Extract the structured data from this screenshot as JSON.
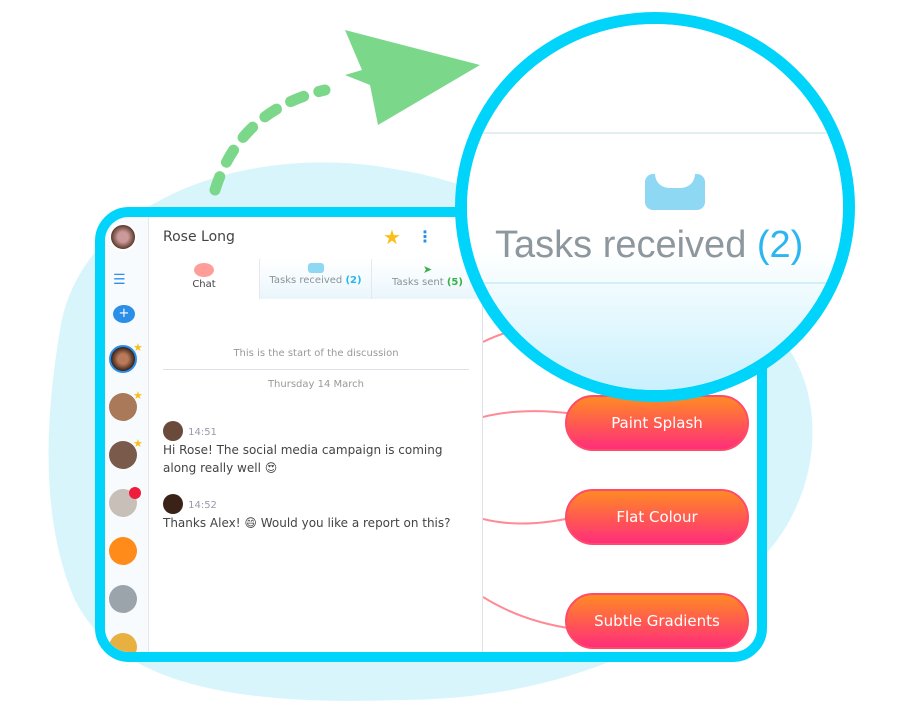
{
  "colors": {
    "accent": "#00d4fb",
    "arrow": "#7bd88a",
    "node": "#ff4a6a",
    "received": "#2bb6f0",
    "sent": "#38b04a"
  },
  "header": {
    "contact_name": "Rose Long",
    "favorite_icon": "star-icon",
    "menu_icon": "more-vertical-icon"
  },
  "tabs": [
    {
      "label": "Chat",
      "icon": "chat-bubble-icon"
    },
    {
      "label": "Tasks received",
      "count": "(2)",
      "icon": "inbox-icon"
    },
    {
      "label": "Tasks sent",
      "count": "(5)",
      "icon": "paper-plane-icon"
    }
  ],
  "chat": {
    "start_notice": "This is the start of the discussion",
    "date": "Thursday 14 March",
    "messages": [
      {
        "time": "14:51",
        "text": "Hi Rose! The social media campaign is coming along really well",
        "emoji": "😍"
      },
      {
        "time": "14:52",
        "text": "Thanks Alex!",
        "emoji": "😄",
        "text_after": "Would you like a report on this?"
      }
    ]
  },
  "mindmap": {
    "nodes": [
      "Paint Splash",
      "Flat Colour",
      "Subtle Gradients"
    ]
  },
  "lens": {
    "label": "Tasks received",
    "count": "(2)"
  }
}
